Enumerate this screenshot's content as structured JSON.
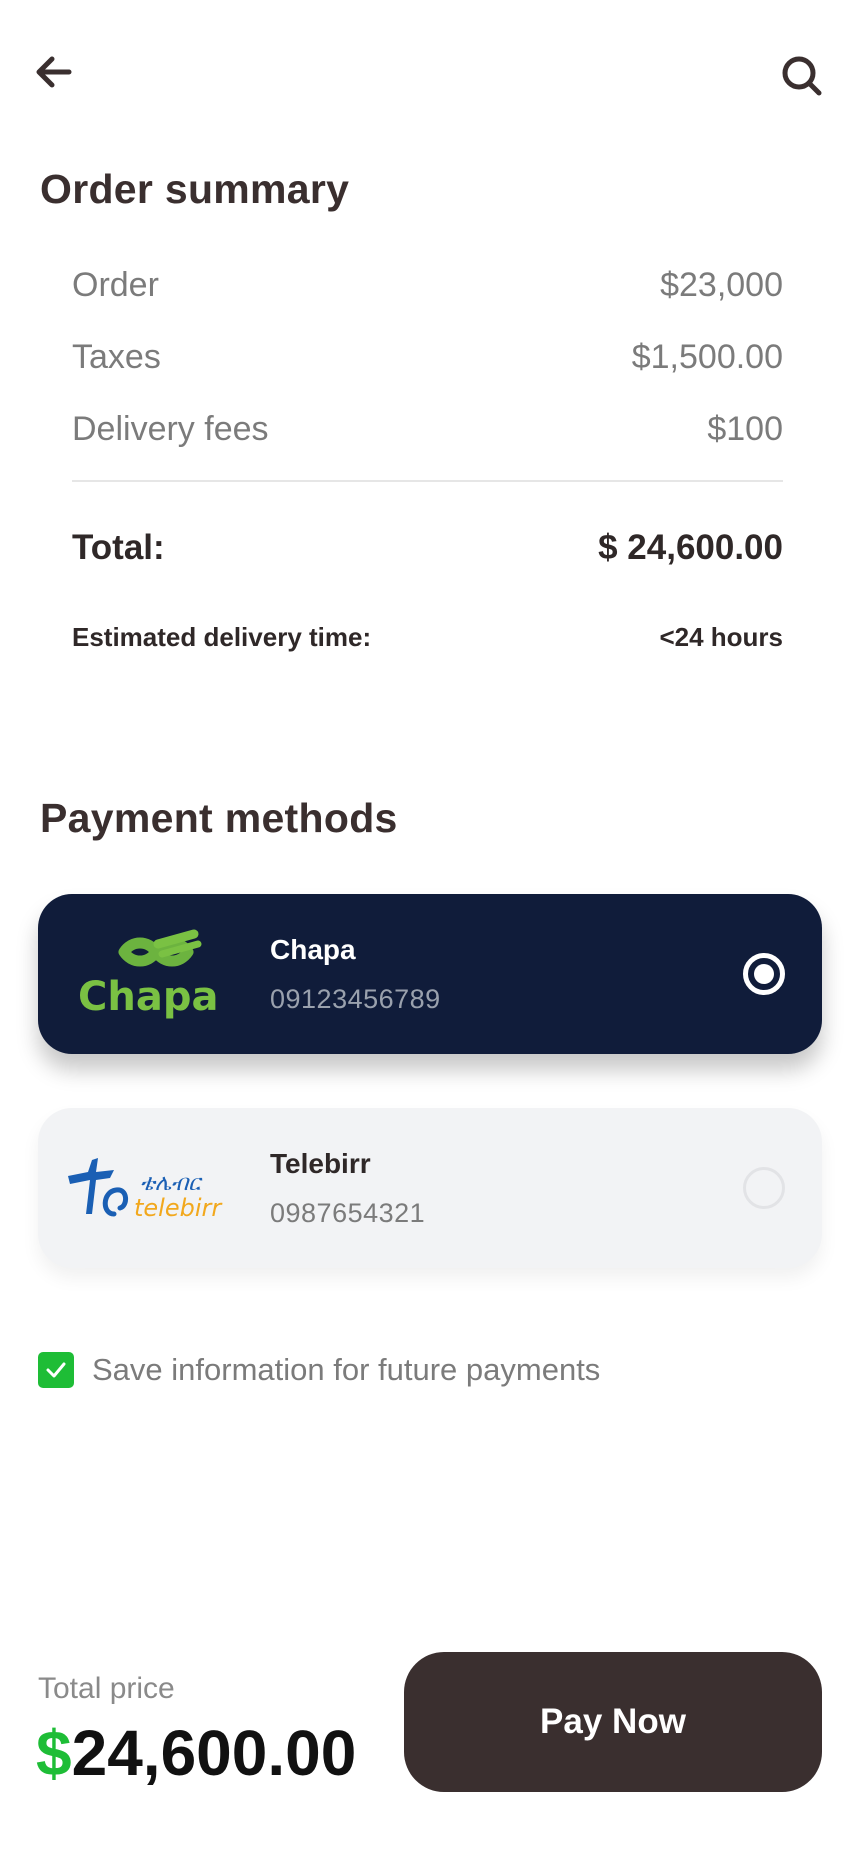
{
  "header": {
    "back_icon": "back-arrow-icon",
    "search_icon": "search-icon"
  },
  "order_summary": {
    "title": "Order summary",
    "rows": [
      {
        "label": "Order",
        "value": "$23,000"
      },
      {
        "label": "Taxes",
        "value": "$1,500.00"
      },
      {
        "label": "Delivery fees",
        "value": "$100"
      }
    ],
    "total": {
      "label": "Total:",
      "value": "$ 24,600.00"
    },
    "eta": {
      "label": "Estimated delivery time:",
      "value": "<24 hours"
    }
  },
  "payment_methods": {
    "title": "Payment methods",
    "items": [
      {
        "name": "Chapa",
        "number": "09123456789",
        "logo_text": "Chapa",
        "selected": true
      },
      {
        "name": "Telebirr",
        "number": "0987654321",
        "logo_text_top": "ቴሌብር",
        "logo_text_bottom": "telebirr",
        "selected": false
      }
    ]
  },
  "save_info": {
    "label": "Save information for future payments",
    "checked": true
  },
  "footer": {
    "total_label": "Total price",
    "currency": "$",
    "amount": "24,600.00",
    "pay_button": "Pay Now"
  },
  "colors": {
    "primary_dark": "#3a2f2f",
    "accent_green": "#1ebd36",
    "card_dark": "#101c3a",
    "card_light": "#f2f3f5",
    "telebirr_blue": "#1a5fb4",
    "telebirr_orange": "#f2a81d",
    "chapa_green": "#7ac143"
  }
}
